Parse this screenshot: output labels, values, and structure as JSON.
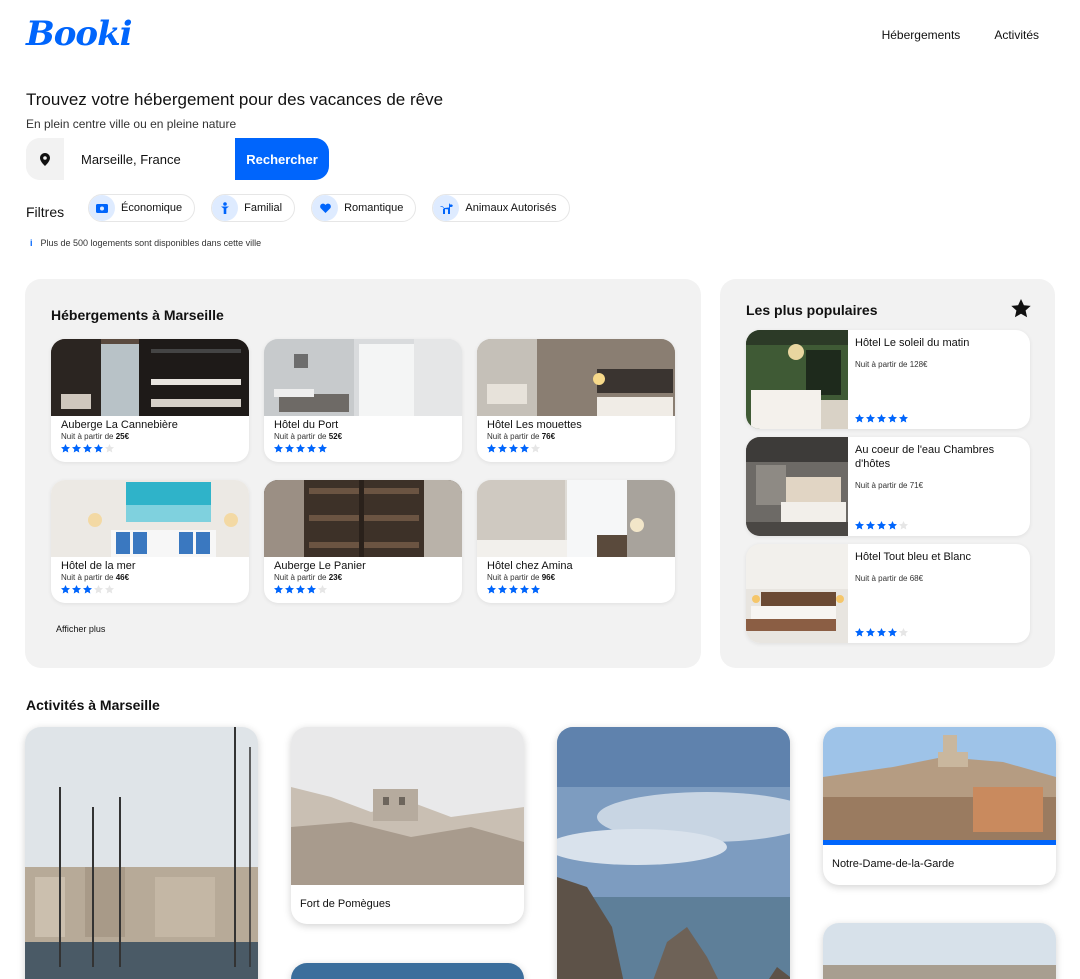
{
  "header": {
    "logo": "Booki",
    "nav": [
      "Hébergements",
      "Activités"
    ]
  },
  "hero": {
    "title": "Trouvez votre hébergement pour des vacances de rêve",
    "subtitle": "En plein centre ville ou en pleine nature",
    "search_value": "Marseille, France",
    "search_button": "Rechercher"
  },
  "filters": {
    "label": "Filtres",
    "items": [
      {
        "label": "Économique",
        "icon": "money-icon"
      },
      {
        "label": "Familial",
        "icon": "child-icon"
      },
      {
        "label": "Romantique",
        "icon": "heart-icon"
      },
      {
        "label": "Animaux Autorisés",
        "icon": "dog-icon"
      }
    ],
    "info_icon": "i",
    "info": "Plus de 500 logements sont disponibles dans cette ville"
  },
  "accommodations": {
    "title": "Hébergements à Marseille",
    "price_prefix": "Nuit à partir de",
    "items": [
      {
        "name": "Auberge La Cannebière",
        "price": "25€",
        "rating": 4
      },
      {
        "name": "Hôtel du Port",
        "price": "52€",
        "rating": 5
      },
      {
        "name": "Hôtel Les mouettes",
        "price": "76€",
        "rating": 4
      },
      {
        "name": "Hôtel de la mer",
        "price": "46€",
        "rating": 3
      },
      {
        "name": "Auberge Le Panier",
        "price": "23€",
        "rating": 4
      },
      {
        "name": "Hôtel chez Amina",
        "price": "96€",
        "rating": 5
      }
    ],
    "more": "Afficher plus"
  },
  "popular": {
    "title": "Les plus populaires",
    "items": [
      {
        "name": "Hôtel Le soleil du matin",
        "price_text": "Nuit à partir de 128€",
        "rating": 5
      },
      {
        "name": "Au coeur de l'eau Chambres d'hôtes",
        "price_text": "Nuit à partir de 71€",
        "rating": 4
      },
      {
        "name": "Hôtel Tout bleu et Blanc",
        "price_text": "Nuit à partir de 68€",
        "rating": 4
      }
    ]
  },
  "activities": {
    "title": "Activités à Marseille",
    "items": [
      "Fort de Pomègues",
      "Notre-Dame-de-la-Garde"
    ]
  },
  "colors": {
    "primary": "#0065FC",
    "light_blue": "#DEEBFF",
    "panel_bg": "#F2F2F2"
  }
}
